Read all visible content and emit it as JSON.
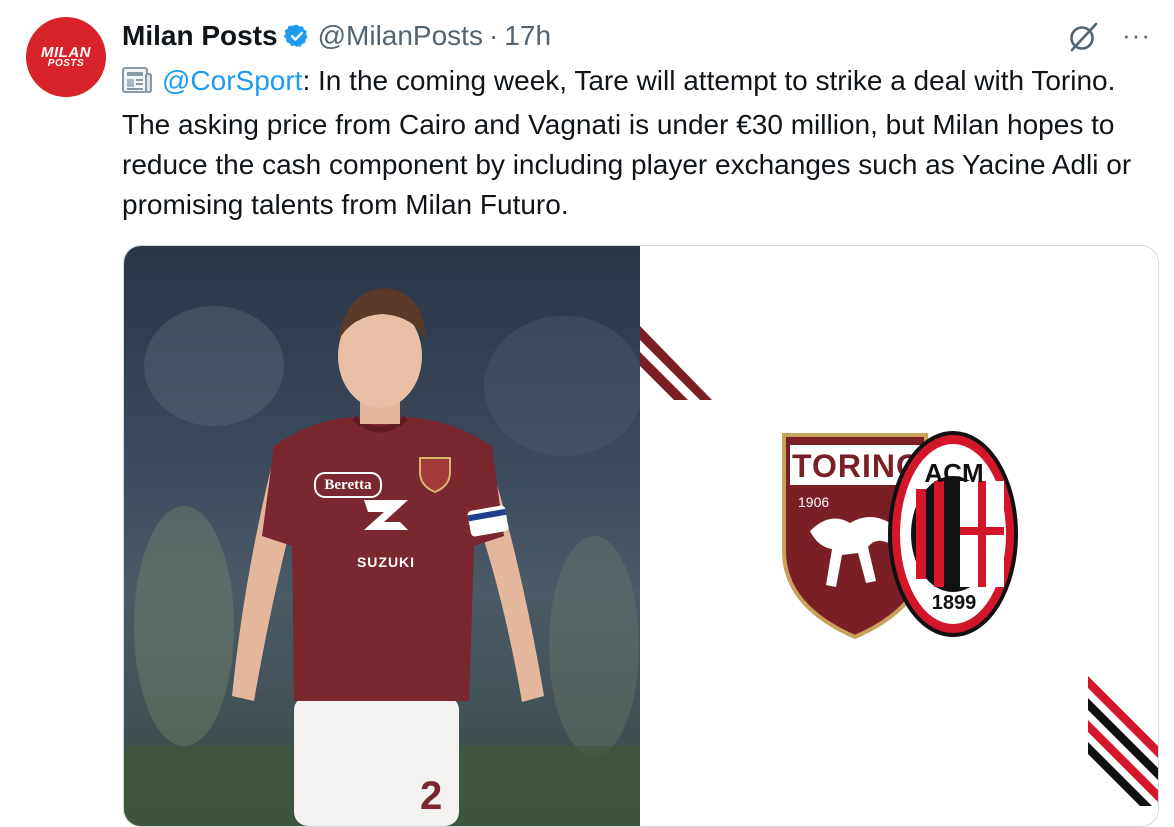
{
  "account": {
    "avatar_line1": "MILAN",
    "avatar_line2": "POSTS",
    "name": "Milan Posts",
    "handle": "@MilanPosts",
    "separator": "·",
    "time": "17h"
  },
  "actions": {
    "more_label": "···"
  },
  "tweet": {
    "mention": "@CorSport",
    "body": ": In the coming week, Tare will attempt to strike a deal with Torino. The asking price from Cairo and Vagnati is under €30 million, but Milan hopes to reduce the cash component by including player exchanges such as Yacine Adli or promising talents from Milan Futuro."
  },
  "media": {
    "jersey": {
      "sponsor_top": "Beretta",
      "sponsor_main": "SUZUKI",
      "number": "2"
    },
    "torino_crest": {
      "name": "TORINO",
      "year": "1906"
    },
    "milan_crest": {
      "name": "ACM",
      "year": "1899"
    }
  },
  "colors": {
    "brand_red": "#d9232a",
    "link_blue": "#1d9bf0",
    "verified_blue": "#1d9bf0",
    "torino_maroon": "#7a1f26",
    "milan_red": "#d4162b",
    "secondary_text": "#536471"
  }
}
